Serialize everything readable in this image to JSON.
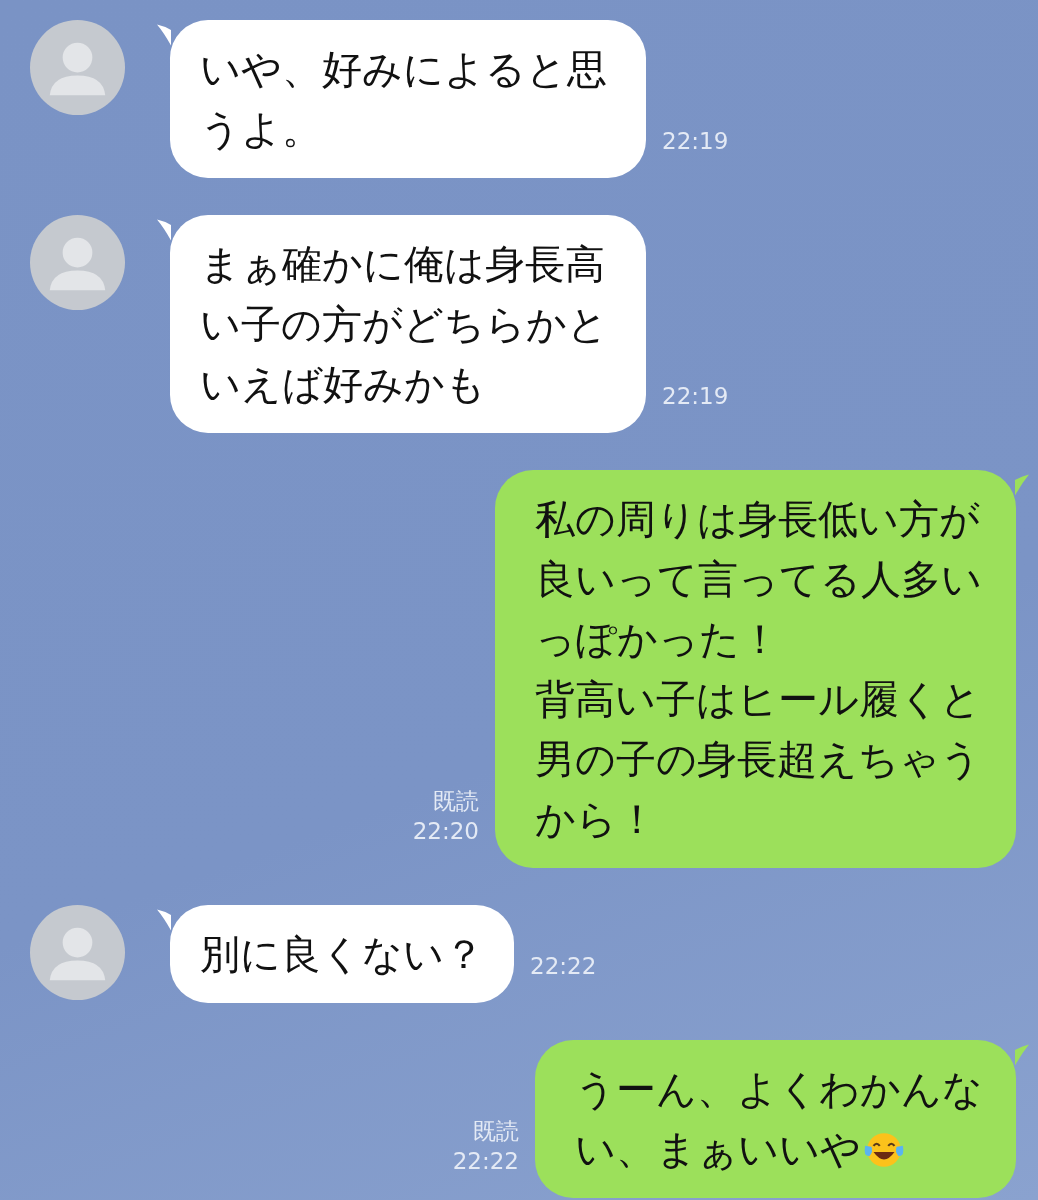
{
  "messages": [
    {
      "kind": "received",
      "paragraphs": [
        "いや、好みによると思うよ。"
      ],
      "time": "22:19"
    },
    {
      "kind": "received",
      "paragraphs": [
        "まぁ確かに俺は身長高い子の方がどちらかといえば好みかも"
      ],
      "time": "22:19"
    },
    {
      "kind": "sent",
      "paragraphs": [
        "私の周りは身長低い方が良いって言ってる人多いっぽかった！",
        "背高い子はヒール履くと男の子の身長超えちゃうから！"
      ],
      "read_label": "既読",
      "time": "22:20"
    },
    {
      "kind": "received",
      "paragraphs": [
        "別に良くない？"
      ],
      "time": "22:22"
    },
    {
      "kind": "sent",
      "paragraphs": [
        "うーん、よくわかんない、まぁいいや"
      ],
      "has_emoji": true,
      "read_label": "既読",
      "time": "22:22"
    }
  ]
}
